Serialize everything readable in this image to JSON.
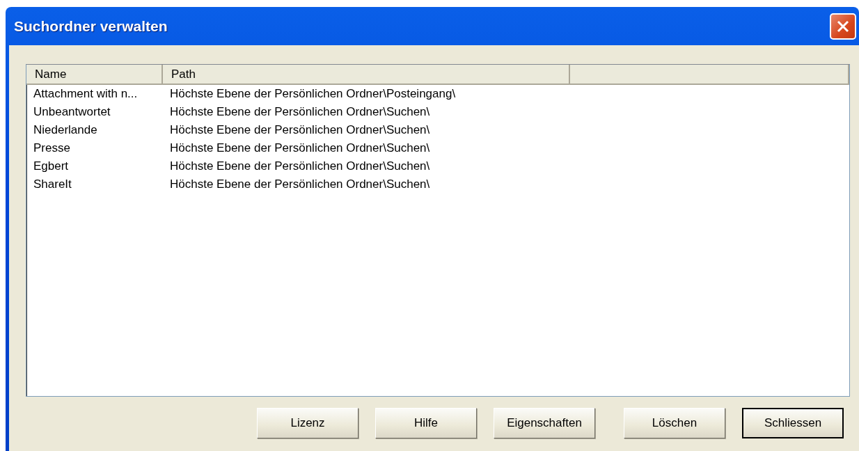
{
  "window": {
    "title": "Suchordner verwalten"
  },
  "table": {
    "columns": [
      "Name",
      "Path"
    ],
    "rows": [
      {
        "name": "Attachment with n...",
        "path": "Höchste Ebene der Persönlichen Ordner\\Posteingang\\"
      },
      {
        "name": "Unbeantwortet",
        "path": "Höchste Ebene der Persönlichen Ordner\\Suchen\\"
      },
      {
        "name": "Niederlande",
        "path": "Höchste Ebene der Persönlichen Ordner\\Suchen\\"
      },
      {
        "name": "Presse",
        "path": "Höchste Ebene der Persönlichen Ordner\\Suchen\\"
      },
      {
        "name": "Egbert",
        "path": "Höchste Ebene der Persönlichen Ordner\\Suchen\\"
      },
      {
        "name": "ShareIt",
        "path": "Höchste Ebene der Persönlichen Ordner\\Suchen\\"
      }
    ]
  },
  "buttons": [
    {
      "label": "Lizenz",
      "default": false
    },
    {
      "label": "Hilfe",
      "default": false
    },
    {
      "label": "Eigenschaften",
      "default": false
    },
    {
      "label": "Löschen",
      "default": false
    },
    {
      "label": "Schliessen",
      "default": true
    }
  ]
}
